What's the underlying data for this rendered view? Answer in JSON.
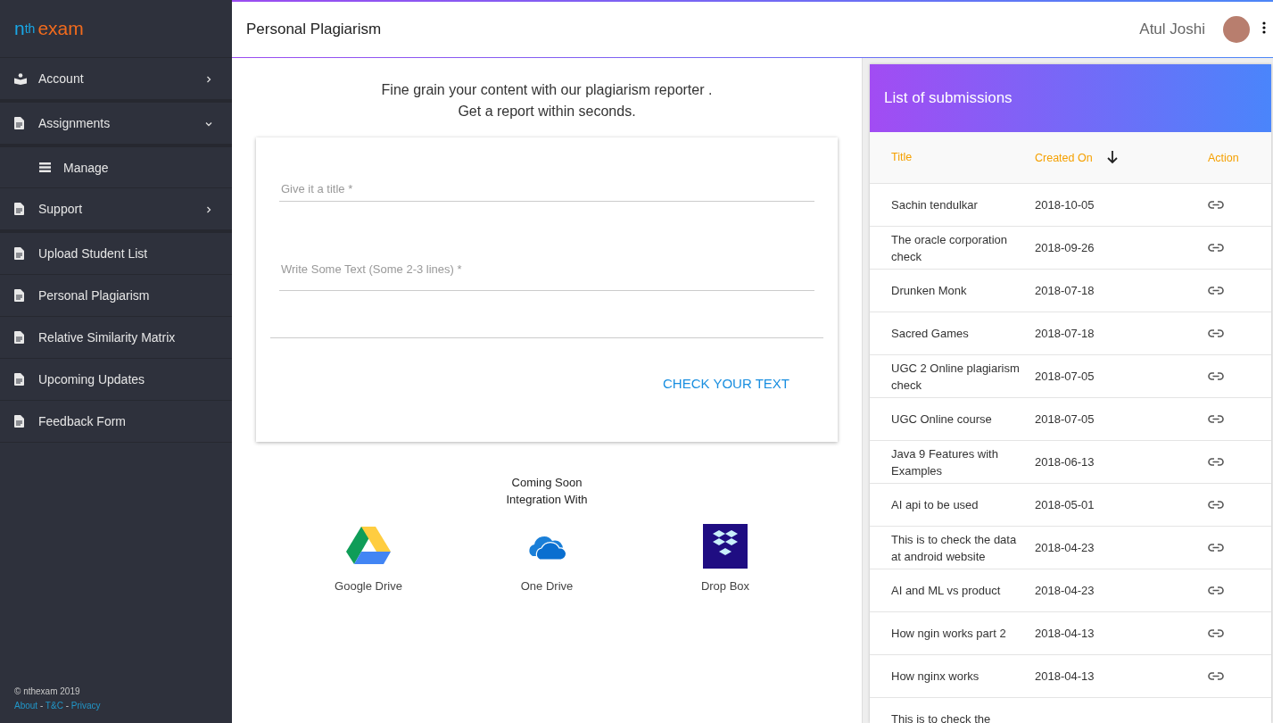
{
  "logo": {
    "prefix": "n",
    "superscript": "th",
    "suffix": "exam"
  },
  "sidebar": {
    "items": [
      {
        "label": "Account",
        "kind": "group",
        "expanded": false
      },
      {
        "label": "Assignments",
        "kind": "group",
        "expanded": true,
        "children": [
          {
            "label": "Manage"
          }
        ]
      },
      {
        "label": "Support",
        "kind": "group",
        "expanded": false
      },
      {
        "label": "Upload Student List",
        "kind": "link"
      },
      {
        "label": "Personal Plagiarism",
        "kind": "link"
      },
      {
        "label": "Relative Similarity Matrix",
        "kind": "link"
      },
      {
        "label": "Upcoming Updates",
        "kind": "link"
      },
      {
        "label": "Feedback Form",
        "kind": "link"
      }
    ],
    "footer": {
      "copyright": "© nthexam 2019",
      "line": [
        {
          "kind": "link",
          "text": "About"
        },
        {
          "kind": "sep",
          "text": "-"
        },
        {
          "kind": "link",
          "text": "T&C"
        },
        {
          "kind": "sep",
          "text": "-"
        },
        {
          "kind": "link",
          "text": "Privacy"
        }
      ]
    }
  },
  "topbar": {
    "title": "Personal Plagiarism",
    "user": "Atul Joshi"
  },
  "intro": [
    "Fine grain your content with our plagiarism reporter .",
    "Get a report within seconds."
  ],
  "form": {
    "fields": [
      {
        "kind": "line",
        "placeholder": "Give it a title *"
      },
      {
        "kind": "text",
        "placeholder": "Write Some Text (Some 2-3 lines) *"
      }
    ],
    "submit": "CHECK YOUR TEXT"
  },
  "integrations": {
    "heading": [
      "Coming Soon",
      "Integration With"
    ],
    "items": [
      {
        "kind": "gdrive",
        "label": "Google Drive"
      },
      {
        "kind": "onedrive",
        "label": "One Drive"
      },
      {
        "kind": "dropbox",
        "label": "Drop Box"
      }
    ]
  },
  "submissions": {
    "title": "List of submissions",
    "columns": [
      {
        "label": "Title",
        "sorted": false
      },
      {
        "label": "Created On",
        "sorted": true
      },
      {
        "label": "Action",
        "sorted": false
      }
    ],
    "rows": [
      {
        "title": "Sachin tendulkar",
        "created": "2018-10-05"
      },
      {
        "title": "The oracle corporation check",
        "created": "2018-09-26"
      },
      {
        "title": "Drunken Monk",
        "created": "2018-07-18"
      },
      {
        "title": "Sacred Games",
        "created": "2018-07-18"
      },
      {
        "title": "UGC 2 Online plagiarism check",
        "created": "2018-07-05"
      },
      {
        "title": "UGC Online course",
        "created": "2018-07-05"
      },
      {
        "title": "Java 9 Features with Examples",
        "created": "2018-06-13"
      },
      {
        "title": "AI api to be used",
        "created": "2018-05-01"
      },
      {
        "title": "This is to check the data at android website",
        "created": "2018-04-23"
      },
      {
        "title": "AI and ML vs product",
        "created": "2018-04-23"
      },
      {
        "title": "How ngin works part 2",
        "created": "2018-04-13"
      },
      {
        "title": "How nginx works",
        "created": "2018-04-13"
      },
      {
        "title": "This is to check the"
      }
    ]
  }
}
